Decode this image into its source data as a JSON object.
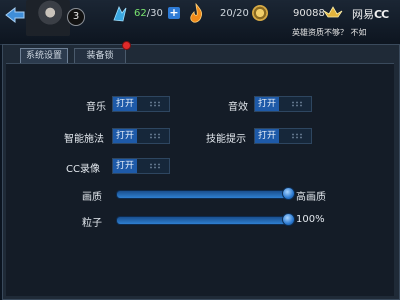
{
  "header": {
    "level": "3",
    "stamina": {
      "current": "62",
      "max": "/30"
    },
    "energy": "20/20",
    "coins": "90088",
    "brand": {
      "prefix": "网易",
      "suffix": "CC"
    },
    "marquee": "英雄资质不够？ 不如"
  },
  "tabs": [
    {
      "label": "系统设置",
      "active": true
    },
    {
      "label": "装备锁",
      "active": false,
      "has_notification": true
    }
  ],
  "settings": {
    "music": {
      "label": "音乐",
      "state": "打开"
    },
    "sound": {
      "label": "音效",
      "state": "打开"
    },
    "smart_cast": {
      "label": "智能施法",
      "state": "打开"
    },
    "skill_tips": {
      "label": "技能提示",
      "state": "打开"
    },
    "cc_record": {
      "label": "CC录像",
      "state": "打开"
    }
  },
  "sliders": {
    "quality": {
      "label": "画质",
      "value_text": "高画质",
      "level": 1.0
    },
    "particles": {
      "label": "粒子",
      "value_text": "100%",
      "level": 1.0
    }
  },
  "colors": {
    "accent": "#1e5aa8",
    "notification": "#e02a2a",
    "stamina_value": "#79e26f"
  }
}
